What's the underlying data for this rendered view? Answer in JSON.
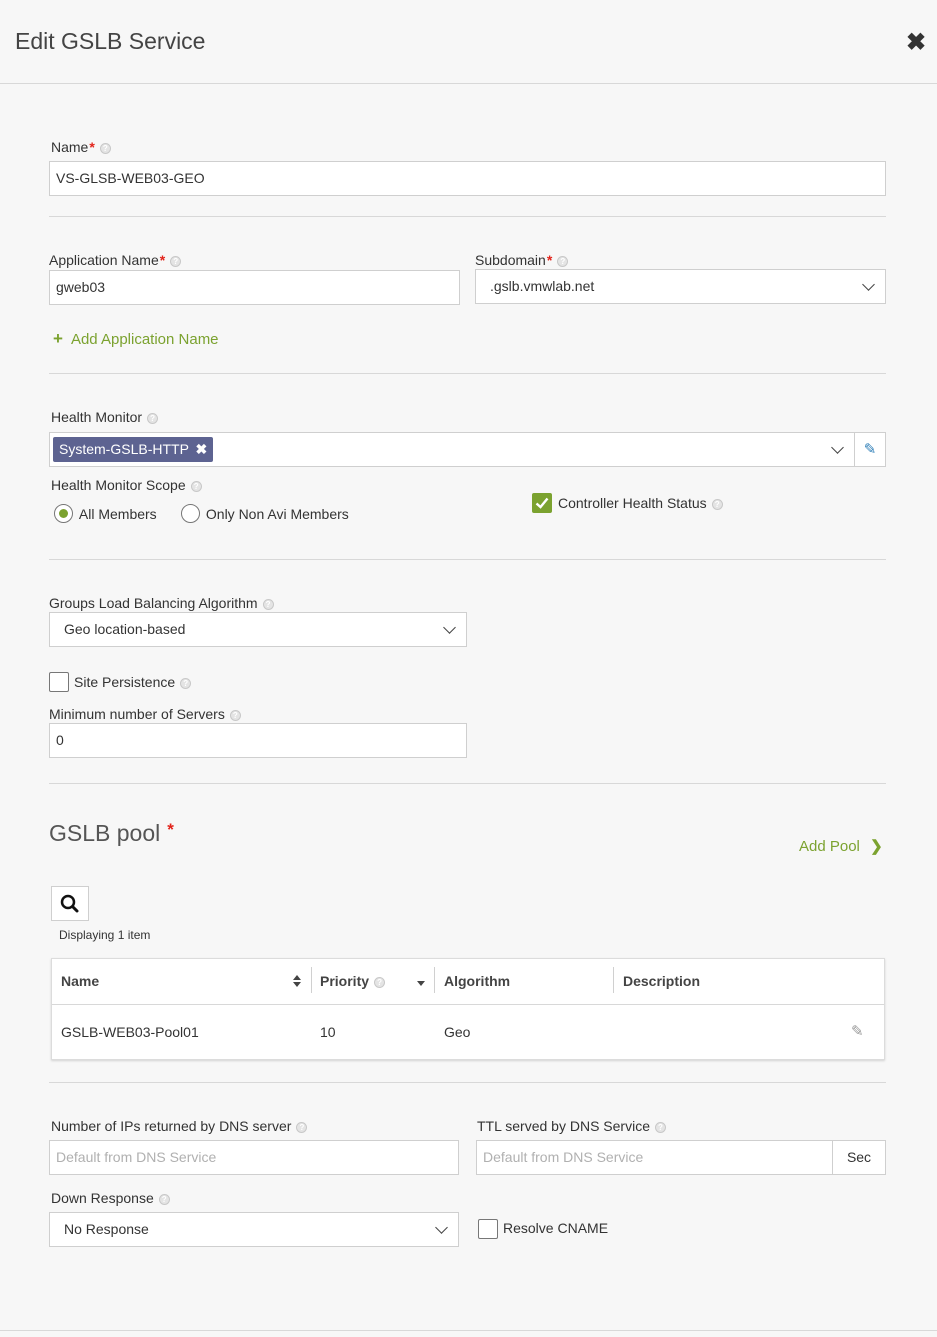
{
  "header": {
    "title": "Edit GSLB Service"
  },
  "name_field": {
    "label": "Name",
    "value": "VS-GLSB-WEB03-GEO"
  },
  "application": {
    "label": "Application Name",
    "value": "gweb03",
    "add_label": "Add Application Name"
  },
  "subdomain": {
    "label": "Subdomain",
    "value": ".gslb.vmwlab.net"
  },
  "health_monitor": {
    "label": "Health Monitor",
    "tag": "System-GSLB-HTTP"
  },
  "health_scope": {
    "label": "Health Monitor Scope",
    "options": [
      "All Members",
      "Only Non Avi Members"
    ],
    "selected": "All Members"
  },
  "controller_health": {
    "label": "Controller Health Status",
    "checked": true
  },
  "algorithm": {
    "label": "Groups Load Balancing Algorithm",
    "value": "Geo location-based"
  },
  "site_persistence": {
    "label": "Site Persistence",
    "checked": false
  },
  "min_servers": {
    "label": "Minimum number of Servers",
    "value": "0"
  },
  "pool": {
    "title": "GSLB pool",
    "add_label": "Add Pool",
    "displaying": "Displaying 1 item",
    "columns": [
      "Name",
      "Priority",
      "Algorithm",
      "Description"
    ],
    "rows": [
      {
        "name": "GSLB-WEB03-Pool01",
        "priority": "10",
        "algorithm": "Geo",
        "description": ""
      }
    ]
  },
  "dns": {
    "ips_label": "Number of IPs returned by DNS server",
    "ips_placeholder": "Default from DNS Service",
    "ttl_label": "TTL served by DNS Service",
    "ttl_placeholder": "Default from DNS Service",
    "ttl_unit": "Sec"
  },
  "down_response": {
    "label": "Down Response",
    "value": "No Response"
  },
  "resolve_cname": {
    "label": "Resolve CNAME",
    "checked": false
  },
  "colors": {
    "accent": "#7ba22f",
    "tag": "#5d6391",
    "required": "#e2231a"
  }
}
